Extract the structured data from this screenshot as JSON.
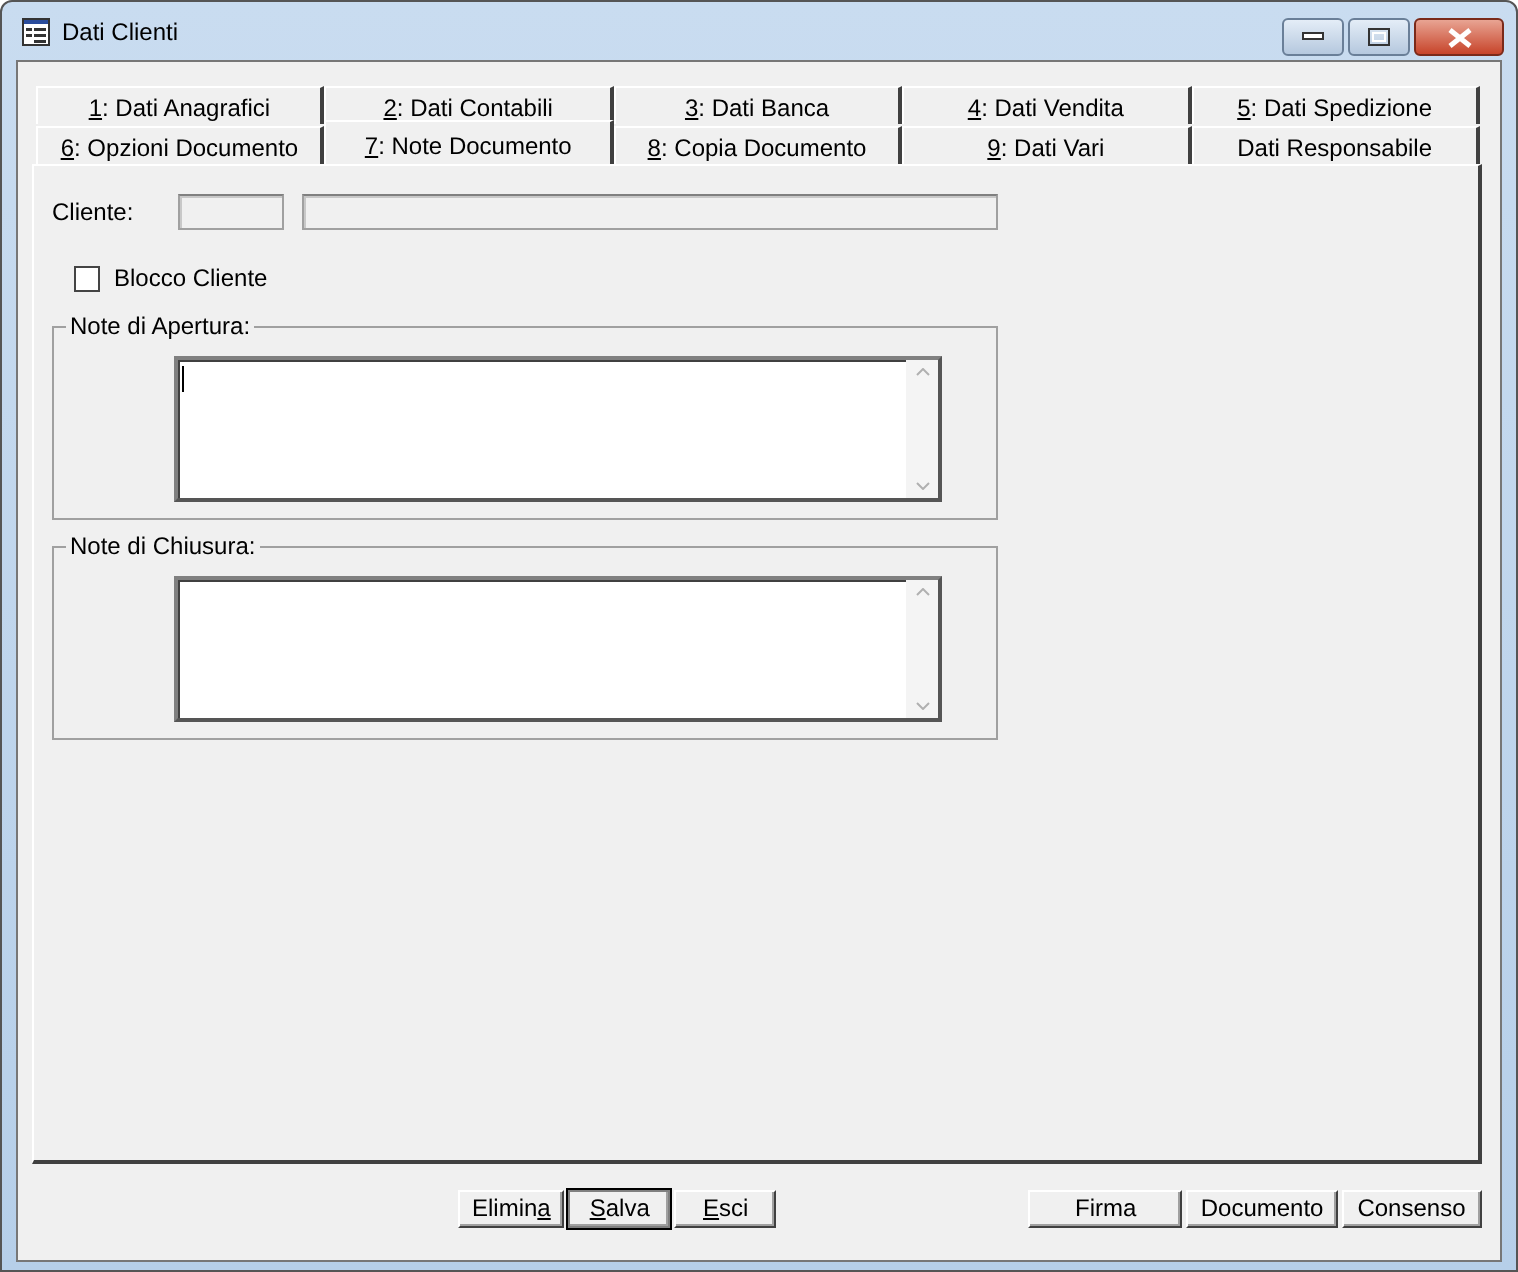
{
  "window": {
    "title": "Dati Clienti"
  },
  "tab_rows": [
    [
      {
        "key": "1",
        "post": ": Dati Anagrafici",
        "selected": false
      },
      {
        "key": "2",
        "post": ": Dati Contabili",
        "selected": false
      },
      {
        "key": "3",
        "post": ": Dati Banca",
        "selected": false
      },
      {
        "key": "4",
        "post": ": Dati Vendita",
        "selected": false
      },
      {
        "key": "5",
        "post": ": Dati Spedizione",
        "selected": false
      }
    ],
    [
      {
        "key": "6",
        "post": ": Opzioni Documento",
        "selected": false
      },
      {
        "key": "7",
        "post": ": Note Documento",
        "selected": true
      },
      {
        "key": "8",
        "post": ": Copia Documento",
        "selected": false
      },
      {
        "key": "9",
        "post": ": Dati Vari",
        "selected": false
      },
      {
        "pre": "Dati Responsabile",
        "selected": false
      }
    ]
  ],
  "cliente": {
    "label": "Cliente:"
  },
  "blocco_cliente": {
    "label": "Blocco Cliente",
    "checked": false
  },
  "note_groups": [
    {
      "legend": "Note di Apertura:",
      "focused": true
    },
    {
      "legend": "Note di Chiusura:",
      "focused": false
    }
  ],
  "buttons_left": [
    {
      "pre": "Elimin",
      "key": "a",
      "default": false
    },
    {
      "key": "S",
      "post": "alva",
      "default": true
    },
    {
      "key": "E",
      "post": "sci",
      "default": false
    }
  ],
  "buttons_right": [
    {
      "pre": "Firma",
      "default": false
    },
    {
      "pre": "Documento",
      "default": false
    },
    {
      "pre": "Consenso",
      "default": false
    }
  ]
}
